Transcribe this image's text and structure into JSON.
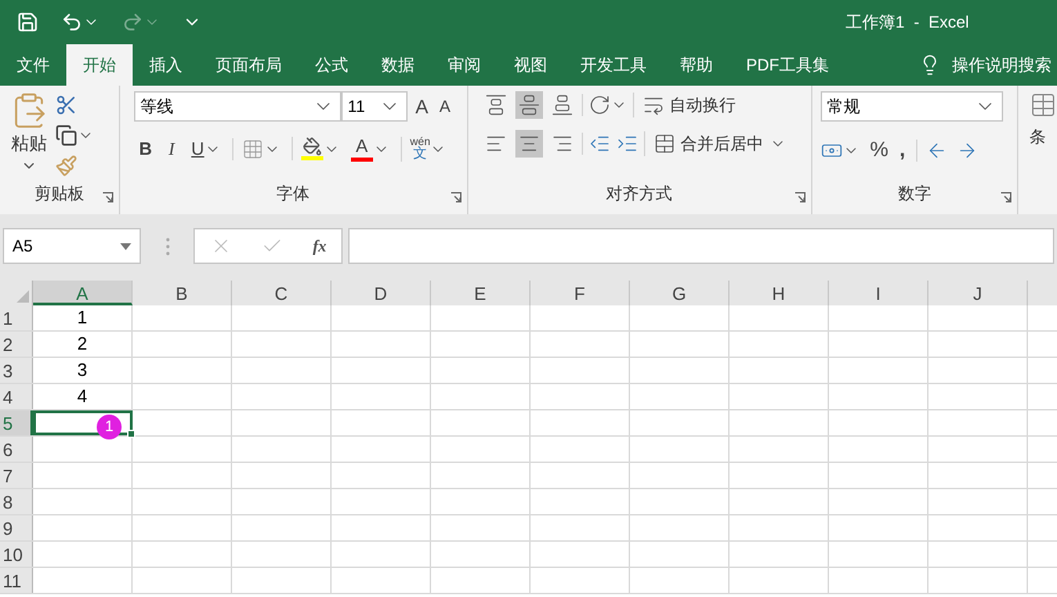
{
  "window": {
    "title": "工作簿1  -  Excel"
  },
  "tabs": [
    {
      "label": "文件",
      "selected": false
    },
    {
      "label": "开始",
      "selected": true
    },
    {
      "label": "插入",
      "selected": false
    },
    {
      "label": "页面布局",
      "selected": false
    },
    {
      "label": "公式",
      "selected": false
    },
    {
      "label": "数据",
      "selected": false
    },
    {
      "label": "审阅",
      "selected": false
    },
    {
      "label": "视图",
      "selected": false
    },
    {
      "label": "开发工具",
      "selected": false
    },
    {
      "label": "帮助",
      "selected": false
    },
    {
      "label": "PDF工具集",
      "selected": false
    }
  ],
  "tell_me": "操作说明搜索",
  "ribbon": {
    "clipboard": {
      "paste": "粘贴",
      "label": "剪贴板"
    },
    "font": {
      "name": "等线",
      "size": "11",
      "grow": "A",
      "shrink": "A",
      "bold": "B",
      "italic": "I",
      "underline": "U",
      "font_color": "A",
      "phonetic_top": "wén",
      "phonetic_bottom": "文",
      "label": "字体"
    },
    "alignment": {
      "wrap": "自动换行",
      "merge": "合并后居中",
      "label": "对齐方式"
    },
    "number": {
      "format": "常规",
      "percent": "%",
      "comma": ",",
      "label": "数字"
    },
    "styles": {
      "label": "条"
    }
  },
  "formula_bar": {
    "name_box": "A5",
    "fx": "fx"
  },
  "sheet": {
    "columns": [
      {
        "label": "A",
        "selected": true
      },
      {
        "label": "B",
        "selected": false
      },
      {
        "label": "C",
        "selected": false
      },
      {
        "label": "D",
        "selected": false
      },
      {
        "label": "E",
        "selected": false
      },
      {
        "label": "F",
        "selected": false
      },
      {
        "label": "G",
        "selected": false
      },
      {
        "label": "H",
        "selected": false
      },
      {
        "label": "I",
        "selected": false
      },
      {
        "label": "J",
        "selected": false
      }
    ],
    "rows": [
      {
        "label": "1",
        "selected": false,
        "cells": [
          {
            "text": "1",
            "active": false
          }
        ]
      },
      {
        "label": "2",
        "selected": false,
        "cells": [
          {
            "text": "2",
            "active": false
          }
        ]
      },
      {
        "label": "3",
        "selected": false,
        "cells": [
          {
            "text": "3",
            "active": false
          }
        ]
      },
      {
        "label": "4",
        "selected": false,
        "cells": [
          {
            "text": "4",
            "active": false
          }
        ]
      },
      {
        "label": "5",
        "selected": true,
        "cells": [
          {
            "active": true,
            "badge": "1"
          }
        ]
      },
      {
        "label": "6",
        "selected": false,
        "cells": []
      },
      {
        "label": "7",
        "selected": false,
        "cells": []
      },
      {
        "label": "8",
        "selected": false,
        "cells": []
      },
      {
        "label": "9",
        "selected": false,
        "cells": []
      },
      {
        "label": "10",
        "selected": false,
        "cells": []
      },
      {
        "label": "11",
        "selected": false,
        "cells": []
      }
    ]
  }
}
